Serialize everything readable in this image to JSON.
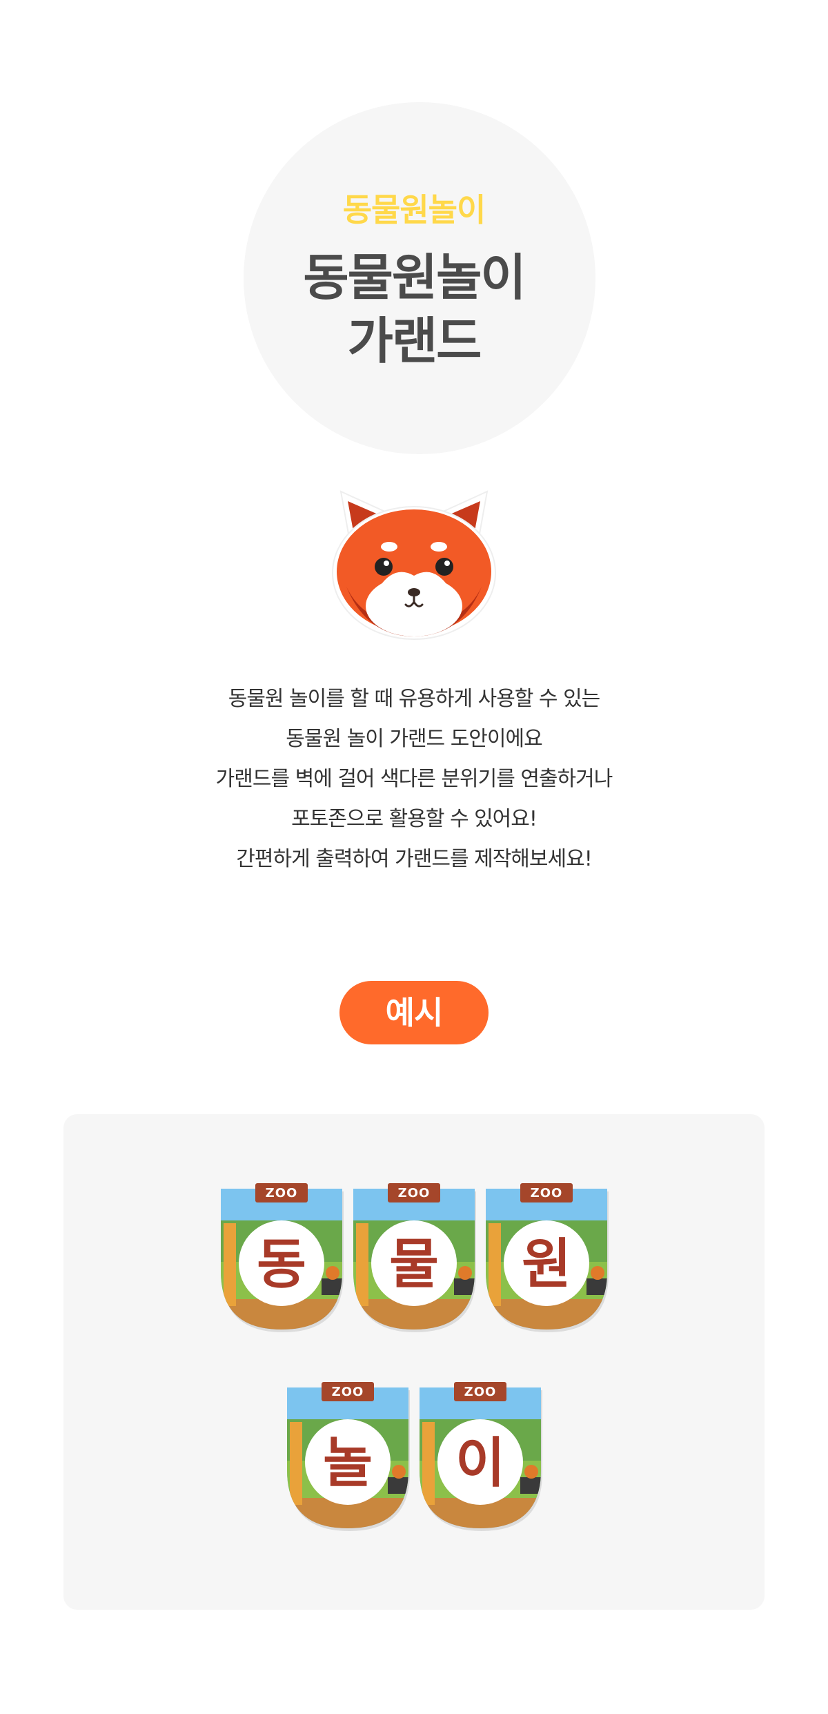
{
  "hero": {
    "subtitle": "동물원놀이",
    "title_line1": "동물원놀이",
    "title_line2": "가랜드"
  },
  "description": [
    "동물원 놀이를 할 때 유용하게 사용할 수 있는",
    "동물원 놀이 가랜드 도안이에요",
    "가랜드를 벽에 걸어 색다른 분위기를 연출하거나",
    "포토존으로 활용할 수 있어요!",
    "간편하게 출력하여 가랜드를 제작해보세요!"
  ],
  "example_label": "예시",
  "garland": {
    "sign_text": "ZOO",
    "flags": [
      "동",
      "물",
      "원",
      "놀",
      "이"
    ]
  },
  "colors": {
    "accent_orange": "#ff6a2b",
    "subtitle_yellow": "#ffd84a",
    "title_gray": "#4b4b4b",
    "letter_brown": "#a83a28"
  }
}
